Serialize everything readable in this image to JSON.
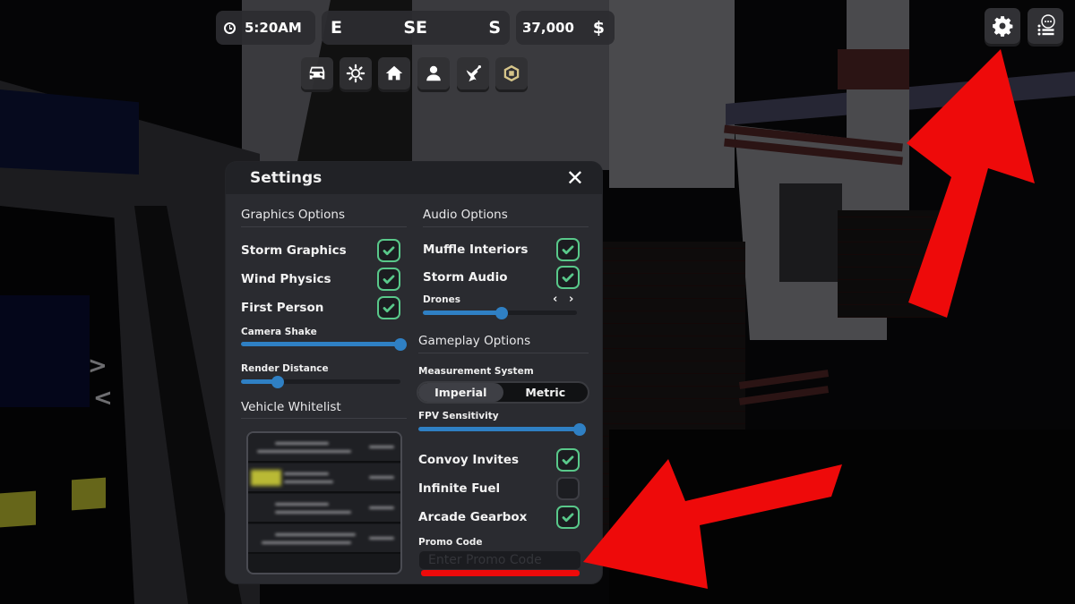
{
  "hud": {
    "time": "5:20AM",
    "compass": [
      "E",
      "SE",
      "S"
    ],
    "money": "37,000",
    "currency_symbol": "$",
    "toolbar_icons": [
      "car-icon",
      "sun-icon",
      "home-icon",
      "person-icon",
      "satellite-dish-icon",
      "robux-icon"
    ],
    "corner_buttons": [
      "settings-gear-icon",
      "chat-list-icon"
    ]
  },
  "settings": {
    "title": "Settings",
    "close_glyph": "✕",
    "graphics": {
      "heading": "Graphics Options",
      "toggles": [
        {
          "label": "Storm Graphics",
          "checked": true
        },
        {
          "label": "Wind Physics",
          "checked": true
        },
        {
          "label": "First Person",
          "checked": true
        }
      ],
      "sliders": [
        {
          "label": "Camera Shake",
          "value": 1.0
        },
        {
          "label": "Render Distance",
          "value": 0.23
        }
      ]
    },
    "vehicle_whitelist": {
      "heading": "Vehicle Whitelist",
      "note": "entries blurred in screenshot"
    },
    "audio": {
      "heading": "Audio Options",
      "toggles": [
        {
          "label": "Muffle Interiors",
          "checked": true
        },
        {
          "label": "Storm Audio",
          "checked": true
        }
      ],
      "drones": {
        "label": "Drones",
        "value": 0.51,
        "prev_glyph": "‹",
        "next_glyph": "›"
      }
    },
    "gameplay": {
      "heading": "Gameplay Options",
      "measurement": {
        "label": "Measurement System",
        "options": [
          "Imperial",
          "Metric"
        ],
        "selected": "Imperial"
      },
      "fpv_sensitivity": {
        "label": "FPV Sensitivity",
        "value": 1.0
      },
      "toggles": [
        {
          "label": "Convoy Invites",
          "checked": true
        },
        {
          "label": "Infinite Fuel",
          "checked": false
        },
        {
          "label": "Arcade Gearbox",
          "checked": true
        }
      ],
      "promo": {
        "label": "Promo Code",
        "placeholder": "Enter Promo Code",
        "value": ""
      }
    }
  },
  "background": {
    "nav_chevrons": [
      ">",
      "<"
    ]
  },
  "colors": {
    "check_green": "#59c88a",
    "slider_blue": "#2f80c4",
    "annotation_red": "#ee0a0a",
    "panel_bg": "#2a2b30"
  }
}
